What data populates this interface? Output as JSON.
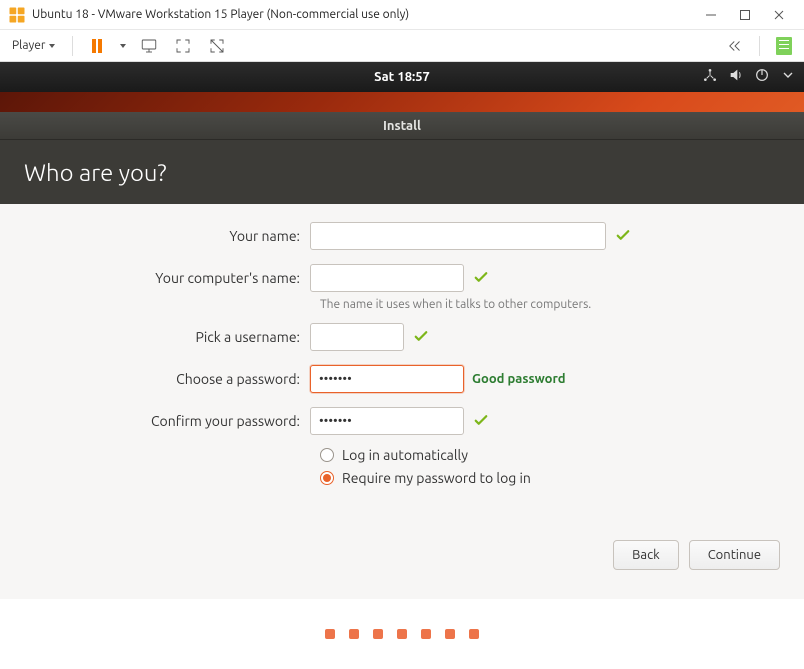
{
  "vmware": {
    "title": "Ubuntu 18 - VMware Workstation 15 Player (Non-commercial use only)",
    "player_label": "Player"
  },
  "ubuntu_bar": {
    "time": "Sat 18:57"
  },
  "installer": {
    "window_title": "Install",
    "heading": "Who are you?",
    "labels": {
      "name": "Your name:",
      "computer": "Your computer's name:",
      "username": "Pick a username:",
      "password": "Choose a password:",
      "confirm": "Confirm your password:"
    },
    "fields": {
      "name_value": "",
      "computer_value": "",
      "computer_helper": "The name it uses when it talks to other computers.",
      "username_value": "",
      "password_value": "•••••••",
      "password_strength": "Good password",
      "confirm_value": "•••••••"
    },
    "login": {
      "auto": "Log in automatically",
      "require": "Require my password to log in",
      "selected": "require"
    },
    "buttons": {
      "back": "Back",
      "continue": "Continue"
    }
  }
}
